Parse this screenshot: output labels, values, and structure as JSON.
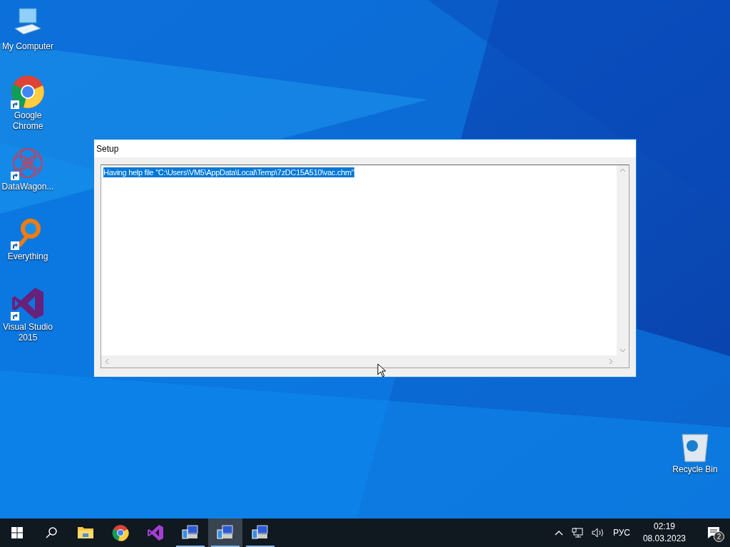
{
  "desktop_icons": [
    {
      "kind": "computer",
      "label": "My Computer",
      "shortcut": false
    },
    {
      "kind": "chrome",
      "label": "Google Chrome",
      "shortcut": true
    },
    {
      "kind": "datawagon",
      "label": "DataWagon...",
      "shortcut": true
    },
    {
      "kind": "everything",
      "label": "Everything",
      "shortcut": true
    },
    {
      "kind": "vs",
      "label": "Visual Studio 2015",
      "shortcut": true
    },
    {
      "kind": "recycle",
      "label": "Recycle Bin",
      "shortcut": false
    }
  ],
  "window": {
    "title": "Setup",
    "log_lines": [
      {
        "text": "Having help file \"C:\\Users\\VM5\\AppData\\Local\\Temp\\7zDC15A510\\vac.chm\"",
        "selected": true
      }
    ]
  },
  "taskbar": {
    "apps": [
      {
        "kind": "explorer",
        "running": false,
        "selected": false
      },
      {
        "kind": "chrome",
        "running": false,
        "selected": false
      },
      {
        "kind": "vs",
        "running": false,
        "selected": false
      },
      {
        "kind": "setup",
        "running": true,
        "selected": false
      },
      {
        "kind": "setup",
        "running": true,
        "selected": true
      },
      {
        "kind": "setup",
        "running": true,
        "selected": false
      }
    ],
    "language": "РУС",
    "time": "02:19",
    "date": "08.03.2023",
    "notifications": "2"
  }
}
